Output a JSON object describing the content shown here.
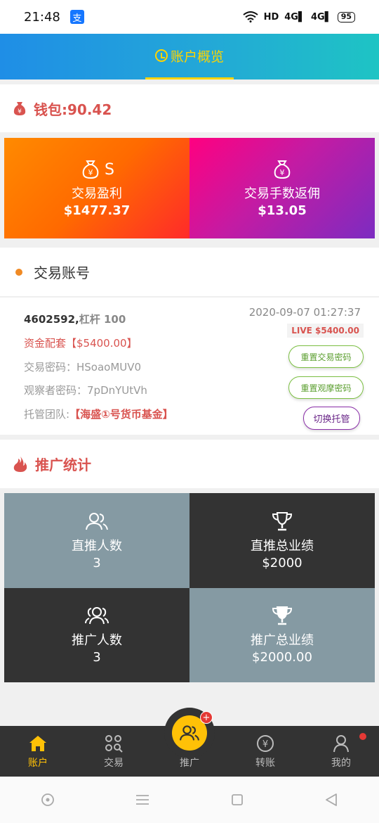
{
  "status_bar": {
    "time": "21:48",
    "app_badge": "支",
    "network": "HD",
    "signal_1": "4G",
    "signal_2": "4G",
    "battery": "95"
  },
  "header": {
    "title": "账户概览"
  },
  "wallet": {
    "label": "钱包:90.42"
  },
  "stats": [
    {
      "title": "交易盈利",
      "value": "$1477.37"
    },
    {
      "title": "交易手数返佣",
      "value": "$13.05"
    }
  ],
  "stat_extra_symbol": "S",
  "account_section": {
    "title": "交易账号"
  },
  "account": {
    "id": "4602592,",
    "leverage": "杠杆 100",
    "date": "2020-09-07 01:27:37",
    "live_badge": "LIVE $5400.00",
    "fund": "资金配套【$5400.00】",
    "trade_password": "交易密码：HSoaoMUV0",
    "observer_password": "观察者密码：7pDnYUtVh",
    "team_label": "托管团队:",
    "team_name": "【海盛①号货币基金】",
    "btn_reset_trade": "重置交易密码",
    "btn_reset_observer": "重置观摩密码",
    "btn_switch": "切换托管"
  },
  "promo_section": {
    "title": "推广统计"
  },
  "promo": [
    {
      "title": "直推人数",
      "value": "3"
    },
    {
      "title": "直推总业绩",
      "value": "$2000"
    },
    {
      "title": "推广人数",
      "value": "3"
    },
    {
      "title": "推广总业绩",
      "value": "$2000.00"
    }
  ],
  "tabbar": {
    "items": [
      {
        "label": "账户",
        "icon": "home-icon"
      },
      {
        "label": "交易",
        "icon": "grid-search-icon"
      },
      {
        "label": "推广",
        "icon": "users-icon"
      },
      {
        "label": "转账",
        "icon": "yen-circle-icon"
      },
      {
        "label": "我的",
        "icon": "user-icon"
      }
    ],
    "badge": "+"
  },
  "colors": {
    "accent": "#ffc107",
    "red": "#d9534f",
    "header_blue": "#1f8ee6",
    "tab_dark": "#333333",
    "tile_gray": "#859aa3"
  }
}
